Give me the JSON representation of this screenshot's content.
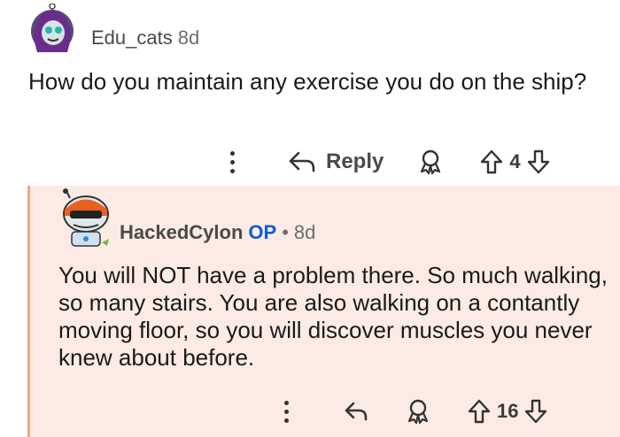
{
  "comment1": {
    "username": "Edu_cats",
    "age": "8d",
    "body": "How do you maintain any exercise you do on the ship?",
    "reply_label": "Reply",
    "vote_count": "4"
  },
  "comment2": {
    "username": "HackedCylon",
    "op_badge": "OP",
    "separator": "•",
    "age": "8d",
    "body": "You will NOT have a problem there. So much walking, so many stairs. You are also walking on a contantly moving floor, so you will discover muscles you never knew about before.",
    "vote_count": "16"
  },
  "colors": {
    "reply_bg": "#fbebe4",
    "thread_line": "#f4a486",
    "op_blue": "#0a5dd6"
  }
}
